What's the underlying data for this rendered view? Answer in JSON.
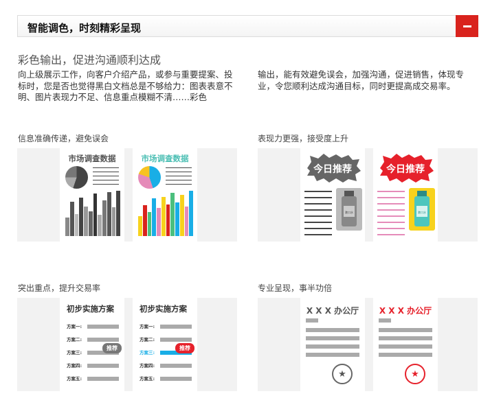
{
  "header": {
    "title": "智能调色，时刻精彩呈现",
    "collapse_icon": "minus-icon",
    "accent_color": "#d9231d"
  },
  "intro": {
    "subtitle": "彩色输出，促进沟通顺利达成",
    "paragraph_left": "向上级展示工作，向客户介绍产品，或参与重要提案、投标时，您是否也觉得黑白文档总是不够给力：图表表意不明、图片表现力不足、信息重点模糊不清……彩色",
    "paragraph_right": "输出，能有效避免误会，加强沟通，促进销售，体现专业，令您顺利达成沟通目标，同时更提高成交易率。"
  },
  "features": [
    {
      "caption": "信息准确传递，避免误会",
      "mono_title": "市场调查数据",
      "color_title": "市场调查数据"
    },
    {
      "caption": "表现力更强，接受度上升",
      "mono_badge": "今日推荐",
      "color_badge": "今日推荐",
      "bottle_label": "漱口水"
    },
    {
      "caption": "突出重点，提升交易率",
      "mono_title": "初步实施方案",
      "color_title": "初步实施方案",
      "rows": [
        "方案一:",
        "方案二:",
        "方案三:",
        "方案四:",
        "方案五:"
      ],
      "tag": "推荐"
    },
    {
      "caption": "专业呈现，事半功倍",
      "mono_title": "X X X 办公厅",
      "color_title": "X X X 办公厅",
      "seal_icon": "star-seal-icon"
    }
  ]
}
